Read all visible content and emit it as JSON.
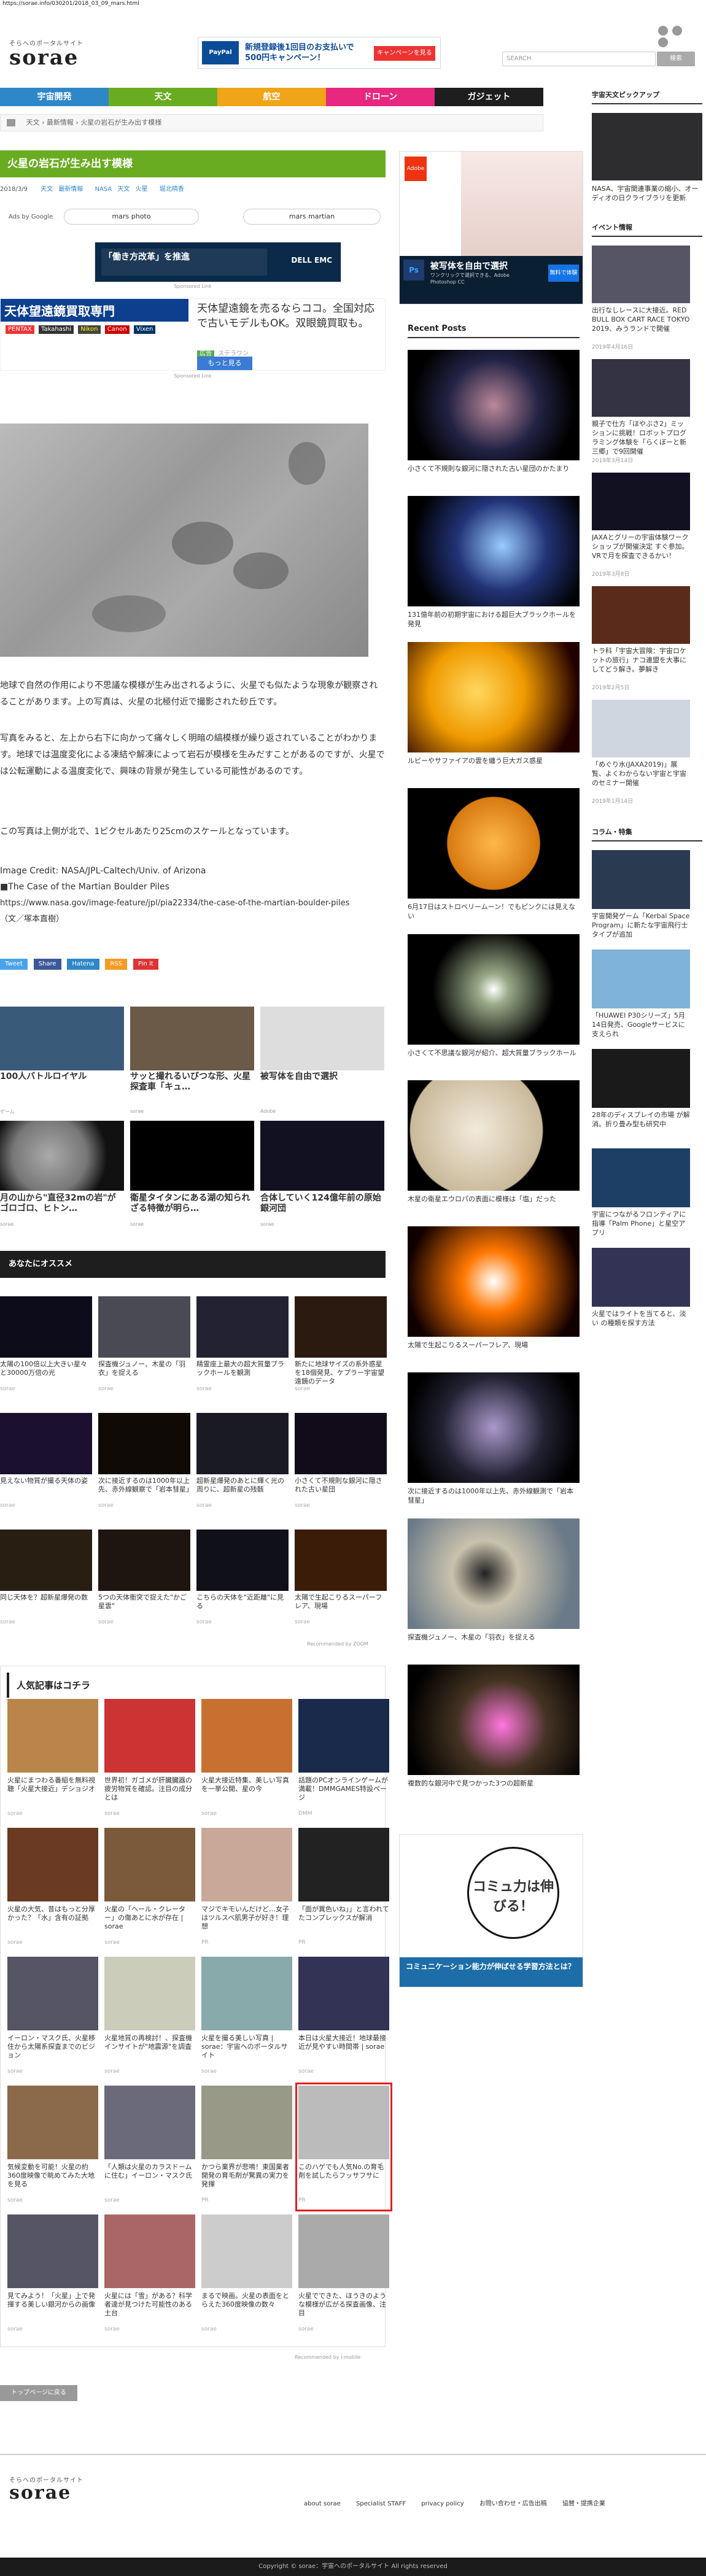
{
  "url": "https://sorae.info/030201/2018_03_09_mars.html",
  "header": {
    "tagline": "そらへのポータルサイト",
    "logo": "sorae",
    "ad_banner": "新規登録後1回目のお支払いで500円キャンペーン！",
    "ad_cta": "キャンペーンを見る",
    "search_placeholder": "SEARCH",
    "search_button": "検索"
  },
  "nav": [
    {
      "label": "宇宙開発",
      "color": "#2e87c8"
    },
    {
      "label": "天文",
      "color": "#6aac21"
    },
    {
      "label": "航空",
      "color": "#f0a418"
    },
    {
      "label": "ドローン",
      "color": "#e8277e"
    },
    {
      "label": "ガジェット",
      "color": "#1e1e1e"
    }
  ],
  "breadcrumb": [
    "天文",
    "最新情報",
    "火星の岩石が生み出す模様"
  ],
  "article": {
    "title": "火星の岩石が生み出す模様",
    "date": "2018/3/9",
    "tags": [
      "天文",
      "最新情報",
      "NASA",
      "天文",
      "火星",
      "堀北晴香"
    ],
    "ads_by": "Ads by Google",
    "pills": [
      "mars photo",
      "mars martian"
    ],
    "sponsor_label": "Sponsored Link",
    "ad2_title": "天体望遠鏡を売るならココ。全国対応で古いモデルもOK。双眼鏡買取も。",
    "ad2_source": "ステラワン",
    "ad2_cta": "もっと見る",
    "ad2_left_title": "天体望遠鏡買取専門",
    "ad2_brands": [
      "PENTAX",
      "Takahashi",
      "Nikon",
      "Canon",
      "Vixen"
    ],
    "paragraphs": [
      "地球で自然の作用により不思議な模様が生み出されるように、火星でも似たような現象が観察されることがあります。上の写真は、火星の北極付近で撮影された砂丘です。",
      "写真をみると、左上から右下に向かって痛々しく明暗の縞模様が繰り返されていることがわかります。地球では温度変化による凍結や解凍によって岩石が模様を生みだすことがあるのですが、火星では公転運動による温度変化で、興味の背景が発生している可能性があるのです。",
      "この写真は上側が北で、1ピクセルあたり25cmのスケールとなっています。"
    ],
    "credit": "Image Credit: NASA/JPL-Caltech/Univ. of Arizona",
    "source_title": "■The Case of the Martian Boulder Piles",
    "source_url": "https://www.nasa.gov/image-feature/jpl/pia22334/the-case-of-the-martian-boulder-piles",
    "author": "（文／塚本直樹）",
    "share": [
      "Tweet",
      "Share",
      "Hatena",
      "RSS",
      "Pin it"
    ]
  },
  "promo_row": [
    {
      "title": "100人バトルロイヤル",
      "src": "ゲーム"
    },
    {
      "title": "サッと撮れるいびつな形、火星探査車「キュ…",
      "src": "sorae"
    },
    {
      "title": "被写体を自由で選択",
      "src": "Adobe"
    }
  ],
  "promo_row2": [
    {
      "title": "月の山から\"直径32mの岩\"がゴロゴロ、ヒトン…",
      "src": "sorae"
    },
    {
      "title": "衛星タイタンにある湖の知られざる特徴が明ら…",
      "src": "sorae"
    },
    {
      "title": "合体していく124億年前の原始銀河団",
      "src": "sorae"
    }
  ],
  "recommend": {
    "heading": "あなたにオススメ",
    "items": [
      "太陽の100倍以上大きい星々と30000万倍の光",
      "探査機ジュノー、木星の「羽衣」を捉える",
      "精霊座上最大の超大質量ブラックホールを観測",
      "新たに地球サイズの系外惑星を18個発見、ケプラー宇宙望遠鏡のデータ",
      "見えない物質が撮る天体の姿",
      "次に接近するのは1000年以上先、赤外線観察で「岩本彗星」",
      "超新星爆発のあとに輝く光の周りに、超新星の残骸",
      "小さくて不規則な銀河に隠された古い星団",
      "同じ天体を？超新星爆発の数",
      "5つの天体衝突で捉えた\"かご星雲\"",
      "こちらの天体を\"近距離\"に見る",
      "太陽で生起こりるスーパーフレア、現場"
    ],
    "recommended_by": "Recommended by",
    "outbrain": "ZOOM"
  },
  "popular": {
    "heading": "人気記事はコチラ",
    "items": [
      {
        "cap": "火星にまつわる番組を無料視聴「火星大接近」デショジオ",
        "src": "sorae"
      },
      {
        "cap": "世界初！ガゴメが肝臓臓器の疲労物質を確認。注目の成分とは",
        "src": "sorae"
      },
      {
        "cap": "火星大接近特集、美しい写真を一挙公開、星の今",
        "src": "sorae"
      },
      {
        "cap": "話題のPCオンラインゲームが満載！DMMGAMES特設ページ",
        "src": "DMM"
      },
      {
        "cap": "火星の大気、昔はもっと分厚かった？「水」含有の証拠",
        "src": "sorae"
      },
      {
        "cap": "火星の「ヘール・クレーター」の傷あとに水が存在 | sorae",
        "src": "sorae"
      },
      {
        "cap": "マジでキモいんだけど…女子はツルスベ肌男子が好き！理想",
        "src": "PR"
      },
      {
        "cap": "「面が異色いね」」と言われてたコンプレックスが解消",
        "src": "PR"
      },
      {
        "cap": "イーロン・マスク氏、火星移住から太陽系探査までのビジョン",
        "src": "sorae"
      },
      {
        "cap": "火星地質の再検討！、探査機インサイトが\"地震源\"を調査",
        "src": "sorae"
      },
      {
        "cap": "火星を撮る美しい写真 | sorae：宇宙へのポータルサイト",
        "src": "sorae"
      },
      {
        "cap": "本日は火星大接近！地球最接近が見やすい時間帯 | sorae",
        "src": "sorae"
      },
      {
        "cap": "気候変動を可能！火星の約360度映像で眺めてみた大地を見る",
        "src": "sorae"
      },
      {
        "cap": "「人類は火星のカラスドームに住む」イーロン・マスク氏",
        "src": "sorae"
      },
      {
        "cap": "かつら業界が悲鳴！東国業者開発の育毛剤が驚異の実力を発揮",
        "src": "PR"
      },
      {
        "cap": "このハゲでも人気No.の育毛剤を試したらフッサフサに",
        "src": "PR"
      },
      {
        "cap": "見てみよう！「火星」上で発揮する美しい銀河からの画像",
        "src": "sorae"
      },
      {
        "cap": "火星には「雪」がある？科学者達が見つけた可能性のある土台",
        "src": "sorae"
      },
      {
        "cap": "まるで映画。火星の表面をとらえた360度映像の数々",
        "src": "sorae"
      },
      {
        "cap": "火星でできた、ほうきのような模様が広がる探査画像、注目",
        "src": "sorae"
      }
    ],
    "recommended_by": "Recommended by",
    "provider": "i-mobile"
  },
  "back_to_top": "トップページに戻る",
  "sidebar_mid": {
    "ad_brand": "Adobe",
    "ad_title": "被写体を自由で選択",
    "ad_sub": "ワンクリックで選択できる、Adobe Photoshop CC",
    "ad_cta": "無料で体験",
    "recent_heading": "Recent Posts",
    "recent": [
      "小さくて不規則な銀河に隠された古い星団のかたまり",
      "131億年前の初期宇宙における超巨大ブラックホールを発見",
      "ルビーやサファイアの雲を纏う巨大ガス惑星",
      "6月17日はストロベリームーン！でもピンクには見えない",
      "小さくて不思議な銀河が紹介、超大質量ブラックホール",
      "木星の衛星エウロパの表面に模様は「塩」だった",
      "太陽で生起こりるスーパーフレア、現場",
      "次に接近するのは1000年以上先、赤外線観測で「岩本彗星」",
      "探査機ジュノー、木星の「羽衣」を捉える",
      "複数的な銀河中で見つかった3つの超新星"
    ],
    "ad2_title": "コミュ力は伸びる！",
    "ad2_sub": "コミュニケーション能力が伸ばせる学習方法とは？"
  },
  "sidebar_right": {
    "pickup_heading": "宇宙天文ピックアップ",
    "pickup_caption": "NASA、宇宙関連事業の縮小、オーディオの日クライブラリを更新",
    "event_heading": "イベント情報",
    "events": [
      {
        "cap": "出行なしレースに大接近。RED BULL BOX CART RACE TOKYO 2019、みうランドで開催",
        "date": "2019年4月16日"
      },
      {
        "cap": "親子で仕方「ほやぶさ2」ミッションに挑戦！ロボットプログラミング体験を「らくぼーと新三郷」で9回開催",
        "date": "2019年3月14日"
      },
      {
        "cap": "JAXAとグリーの宇宙体験ワークショップが開催決定 すぐ参加。VRで月を探査できるかい！",
        "date": "2019年3月8日"
      },
      {
        "cap": "トラ科「宇宙大冒険：宇宙ロケットの旅行」ナコ連盟を大事にしてどう解き。夢解き",
        "date": "2019年2月5日"
      },
      {
        "cap": "「めぐり水(JAXA2019)」展覧、よくわからない宇宙と宇宙のセミナー開催",
        "date": "2019年1月14日"
      }
    ],
    "column_heading": "コラム・特集",
    "columns": [
      "宇宙開発ゲーム「Kerbal Space Program」に新たな宇宙飛行士タイプが追加",
      "「HUAWEI P30シリーズ」5月14日発売、Googleサービスに支えられ",
      "28年のディスプレイの市場 が解消。折り畳み型も研究中",
      "宇宙につながるフロンティアに指導「Palm Phone」と星空アプリ",
      "火星ではライトを当てると、淡い の種類を探す方法"
    ]
  },
  "footer": {
    "tagline": "そらへのポータルサイト",
    "logo": "sorae",
    "links": [
      "about sorae",
      "Specialist STAFF",
      "privacy policy",
      "お問い合わせ・広告出稿",
      "協賛・提携企業"
    ],
    "copyright": "Copyright © sorae：宇宙へのポータルサイト All rights reserved"
  }
}
